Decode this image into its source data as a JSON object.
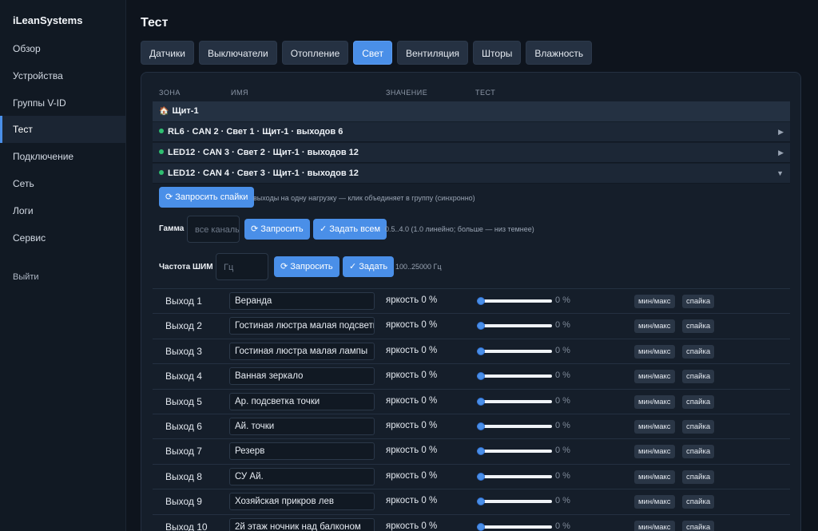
{
  "app": {
    "brand": "iLeanSystems"
  },
  "sidebar": {
    "items": [
      {
        "label": "Обзор"
      },
      {
        "label": "Устройства"
      },
      {
        "label": "Группы V-ID"
      },
      {
        "label": "Тест"
      },
      {
        "label": "Подключение"
      },
      {
        "label": "Сеть"
      },
      {
        "label": "Логи"
      },
      {
        "label": "Сервис"
      }
    ],
    "logout": "Выйти"
  },
  "page": {
    "title": "Тест"
  },
  "tabs": [
    {
      "label": "Датчики"
    },
    {
      "label": "Выключатели"
    },
    {
      "label": "Отопление"
    },
    {
      "label": "Свет",
      "active": true
    },
    {
      "label": "Вентиляция"
    },
    {
      "label": "Шторы"
    },
    {
      "label": "Влажность"
    }
  ],
  "table": {
    "headers": {
      "zone": "ЗОНА",
      "name": "ИМЯ",
      "value": "ЗНАЧЕНИЕ",
      "test": "ТЕСТ"
    },
    "group": {
      "icon": "house-icon",
      "label": "Щит-1"
    },
    "devices": [
      {
        "label": "RL6 · CAN 2 · Свет 1 · Щит-1 · выходов 6",
        "expanded": false
      },
      {
        "label": "LED12 · CAN 3 · Свет 2 · Щит-1 · выходов 12",
        "expanded": false
      },
      {
        "label": "LED12 · CAN 4 · Свет 3 · Щит-1 · выходов 12",
        "expanded": true
      }
    ]
  },
  "controls": {
    "request_spikes_label": "⟳ Запросить спайки",
    "spikes_hint": "выходы на одну нагрузку — клик объединяет в группу (синхронно)",
    "gamma": {
      "label": "Гамма",
      "placeholder": "все каналы",
      "request_label": "⟳ Запросить",
      "set_all_label": "✓ Задать всем",
      "hint": "0.5..4.0 (1.0 линейно; больше — низ темнее)"
    },
    "pwm": {
      "label": "Частота ШИМ",
      "placeholder": "Гц",
      "request_label": "⟳ Запросить",
      "set_label": "✓ Задать",
      "hint": "100..25000 Гц"
    }
  },
  "outputs": [
    {
      "label": "Выход 1",
      "name": "Веранда",
      "brightness": "яркость 0 %",
      "pct": "0 %",
      "level": 0
    },
    {
      "label": "Выход 2",
      "name": "Гостиная люстра малая подсветка",
      "brightness": "яркость 0 %",
      "pct": "0 %",
      "level": 0
    },
    {
      "label": "Выход 3",
      "name": "Гостиная люстра малая лампы",
      "brightness": "яркость 0 %",
      "pct": "0 %",
      "level": 0
    },
    {
      "label": "Выход 4",
      "name": "Ванная зеркало",
      "brightness": "яркость 0 %",
      "pct": "0 %",
      "level": 0
    },
    {
      "label": "Выход 5",
      "name": "Ар. подсветка точки",
      "brightness": "яркость 0 %",
      "pct": "0 %",
      "level": 0
    },
    {
      "label": "Выход 6",
      "name": "Ай. точки",
      "brightness": "яркость 0 %",
      "pct": "0 %",
      "level": 0
    },
    {
      "label": "Выход 7",
      "name": "Резерв",
      "brightness": "яркость 0 %",
      "pct": "0 %",
      "level": 0
    },
    {
      "label": "Выход 8",
      "name": "СУ Ай.",
      "brightness": "яркость 0 %",
      "pct": "0 %",
      "level": 0
    },
    {
      "label": "Выход 9",
      "name": "Хозяйская прикров лев",
      "brightness": "яркость 0 %",
      "pct": "0 %",
      "level": 0
    },
    {
      "label": "Выход 10",
      "name": "2й этаж ночник над балконом",
      "brightness": "яркость 0 %",
      "pct": "0 %",
      "level": 0
    }
  ],
  "row_buttons": {
    "minmax": "мин/макс",
    "spike": "спайка"
  },
  "colors": {
    "accent": "#4a8fe8",
    "online": "#2fbf71",
    "background": "#0e141d"
  }
}
